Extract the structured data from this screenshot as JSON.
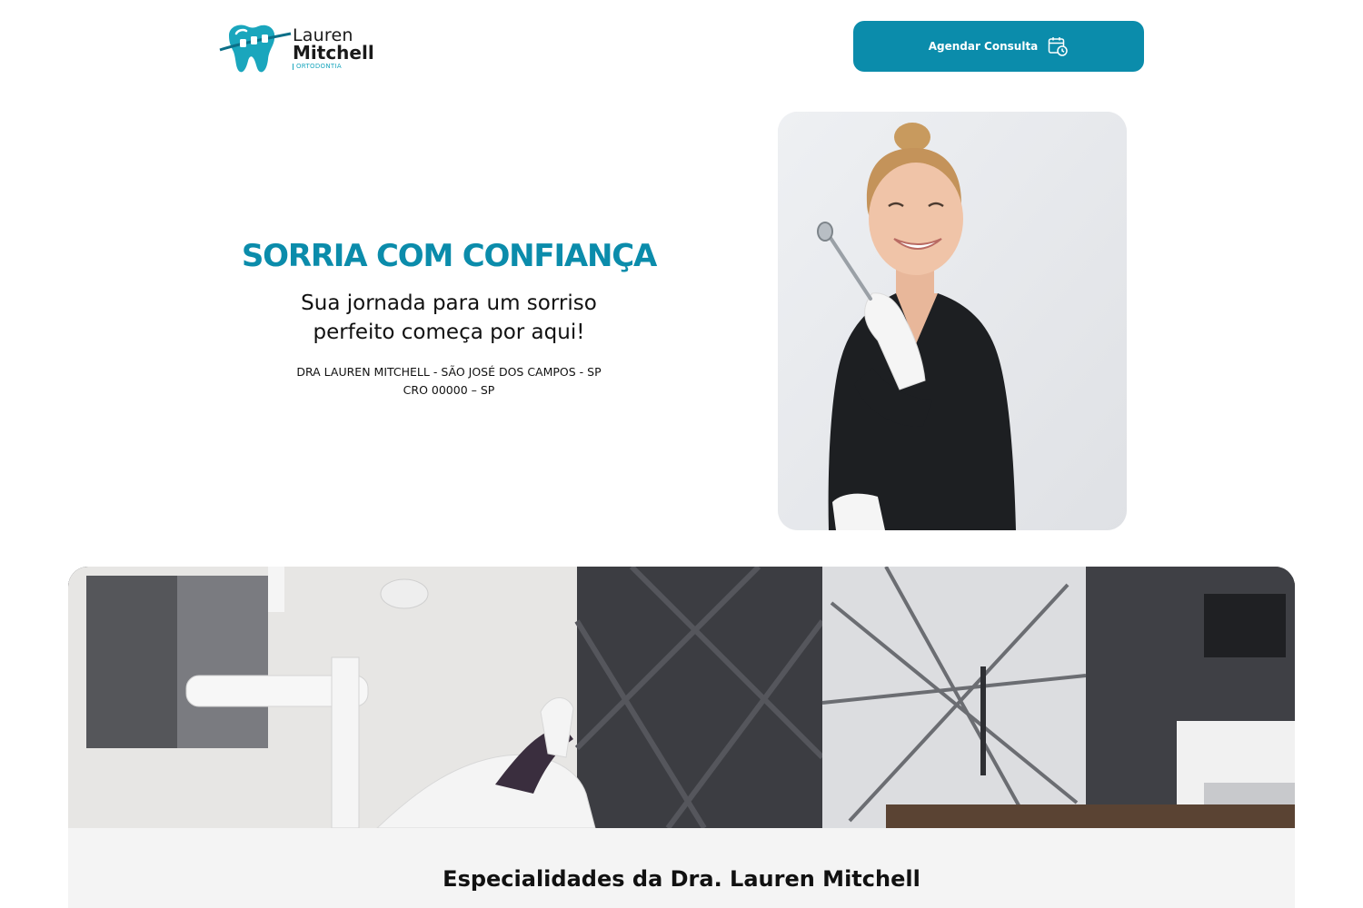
{
  "header": {
    "logo": {
      "line1": "Lauren",
      "line2": "Mitchell",
      "tagline": "ORTODONTIA"
    },
    "cta_label": "Agendar Consulta",
    "cta_icon": "calendar-clock-icon"
  },
  "hero": {
    "title": "SORRIA COM CONFIANÇA",
    "subtitle_line1": "Sua jornada para um sorriso",
    "subtitle_line2": "perfeito começa por aqui!",
    "meta_line1": "DRA LAUREN MITCHELL - SÃO JOSÉ DOS CAMPOS - SP",
    "meta_line2": "CRO 00000 – SP"
  },
  "specialties": {
    "title_prefix": "Especialidades da",
    "title_name": "Dra. Lauren Mitchell"
  },
  "colors": {
    "brand": "#0b8cab",
    "brand_light": "#1aa6bd",
    "section_bg": "#f4f4f4"
  }
}
